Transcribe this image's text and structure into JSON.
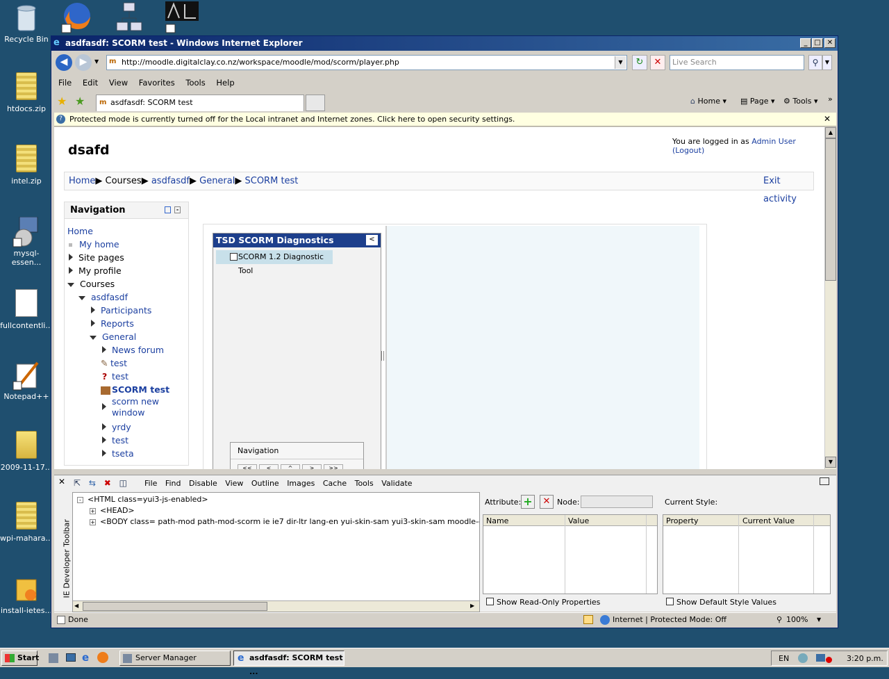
{
  "desktop": {
    "icons": [
      "Recycle Bin",
      "htdocs.zip",
      "intel.zip",
      "mysql-essen...",
      "fullcontentli...",
      "Notepad++",
      "2009-11-17...",
      "wpi-mahara...",
      "install-ietes..."
    ]
  },
  "window": {
    "title": "asdfasdf: SCORM test - Windows Internet Explorer",
    "minimize": "_",
    "maximize": "□",
    "close": "✕"
  },
  "addressbar": {
    "url": "http://moodle.digitalclay.co.nz/workspace/moodle/mod/scorm/player.php",
    "search_placeholder": "Live Search"
  },
  "menu": [
    "File",
    "Edit",
    "View",
    "Favorites",
    "Tools",
    "Help"
  ],
  "tab": {
    "label": "asdfasdf: SCORM test"
  },
  "cmdbar": {
    "home": "Home",
    "page": "Page",
    "tools": "Tools"
  },
  "infobar": {
    "text": "Protected mode is currently turned off for the Local intranet and Internet zones.  Click here to open security settings."
  },
  "page": {
    "site_title": "dsafd",
    "login_prefix": "You are logged in as ",
    "login_user": "Admin User",
    "logout": "(Logout)",
    "breadcrumb": {
      "home": "Home",
      "courses": "Courses",
      "course": "asdfasdf",
      "section": "General",
      "activity": "SCORM test",
      "exit": "Exit activity"
    },
    "nav": {
      "title": "Navigation",
      "home": "Home",
      "my_home": "My home",
      "site_pages": "Site pages",
      "my_profile": "My profile",
      "courses": "Courses",
      "course": "asdfasdf",
      "participants": "Participants",
      "reports": "Reports",
      "general": "General",
      "news": "News forum",
      "test1": "test",
      "test2": "test",
      "scorm_test": "SCORM test",
      "scorm_new_1": "scorm new",
      "scorm_new_2": "window",
      "yrdy": "yrdy",
      "test3": "test",
      "tseta": "tseta"
    },
    "scorm": {
      "toc_title": "TSD SCORM Diagnostics",
      "toc_item": "SCORM 1.2 Diagnostic Tool",
      "nav_title": "Navigation",
      "nav_buttons": [
        "<<",
        "<",
        "^",
        ">",
        ">>"
      ]
    }
  },
  "devtools": {
    "vertical_label": "IE Developer Toolbar",
    "menu": [
      "File",
      "Find",
      "Disable",
      "View",
      "Outline",
      "Images",
      "Cache",
      "Tools",
      "Validate"
    ],
    "dom": [
      "<HTML class=yui3-js-enabled>",
      "<HEAD>",
      "<BODY class= path-mod path-mod-scorm ie ie7 dir-ltr lang-en yui-skin-sam yui3-skin-sam moodle-digitalclay-co-nz-"
    ],
    "attr_label": "Attribute:",
    "node_label": "Node:",
    "attr_cols": [
      "Name",
      "Value"
    ],
    "show_readonly": "Show Read-Only Properties",
    "current_style": "Current Style:",
    "style_cols": [
      "Property",
      "Current Value"
    ],
    "show_default": "Show Default Style Values"
  },
  "status": {
    "text": "Done",
    "zone": "Internet | Protected Mode: Off",
    "zoom": "100%"
  },
  "taskbar": {
    "start": "Start",
    "server_manager": "Server Manager",
    "ie_task": "asdfasdf: SCORM test ...",
    "lang": "EN",
    "clock": "3:20 p.m."
  }
}
